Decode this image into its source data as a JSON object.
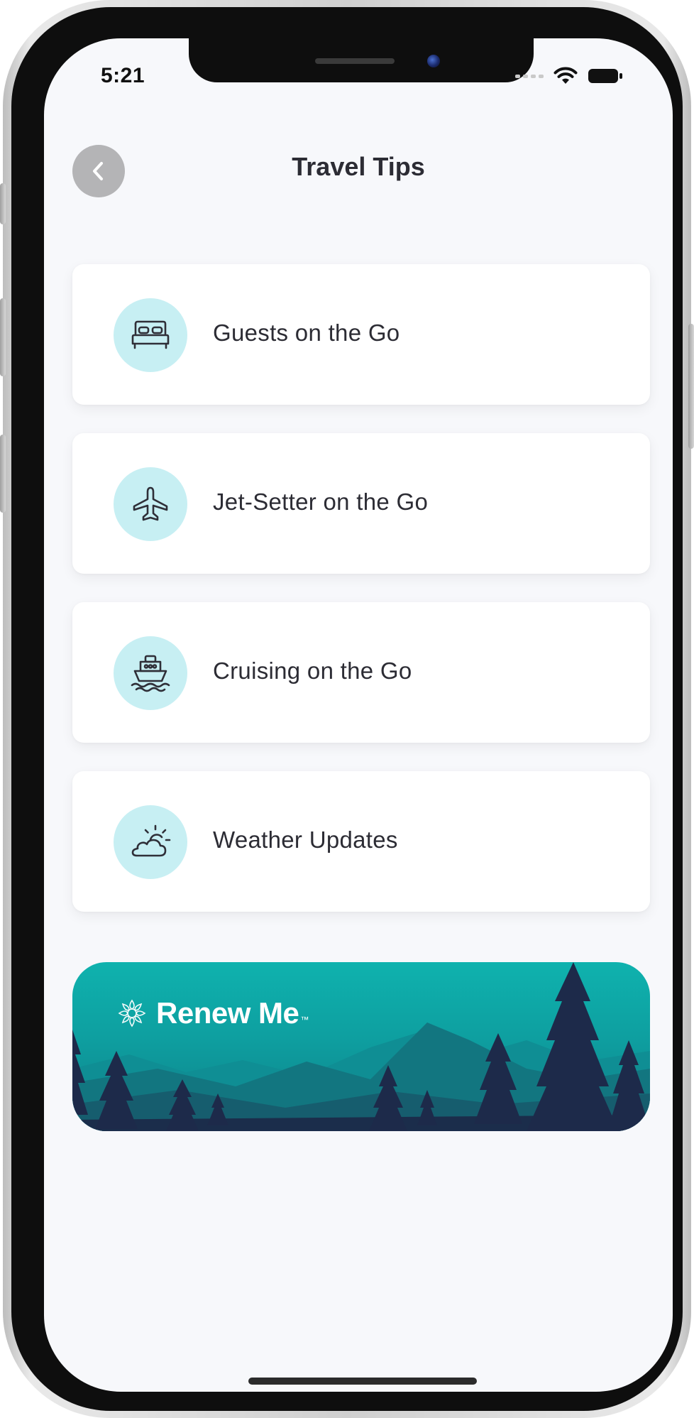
{
  "status_bar": {
    "time": "5:21"
  },
  "header": {
    "title": "Travel Tips",
    "back_icon": "chevron-left-icon"
  },
  "menu": {
    "items": [
      {
        "label": "Guests on the Go",
        "icon": "bed-icon"
      },
      {
        "label": "Jet-Setter on the Go",
        "icon": "airplane-icon"
      },
      {
        "label": "Cruising on the Go",
        "icon": "ship-icon"
      },
      {
        "label": "Weather Updates",
        "icon": "cloud-sun-icon"
      }
    ]
  },
  "banner": {
    "brand": "Renew Me",
    "brand_mark": "™",
    "logo_icon": "mandala-logo-icon"
  },
  "colors": {
    "background": "#f7f8fb",
    "card": "#ffffff",
    "icon_circle": "#c7eff3",
    "icon_stroke": "#2f2f38",
    "text": "#2c2c34",
    "back_button": "#b4b4b6",
    "banner_teal": "#0fb2ae",
    "banner_tree": "#1d2a4a"
  }
}
